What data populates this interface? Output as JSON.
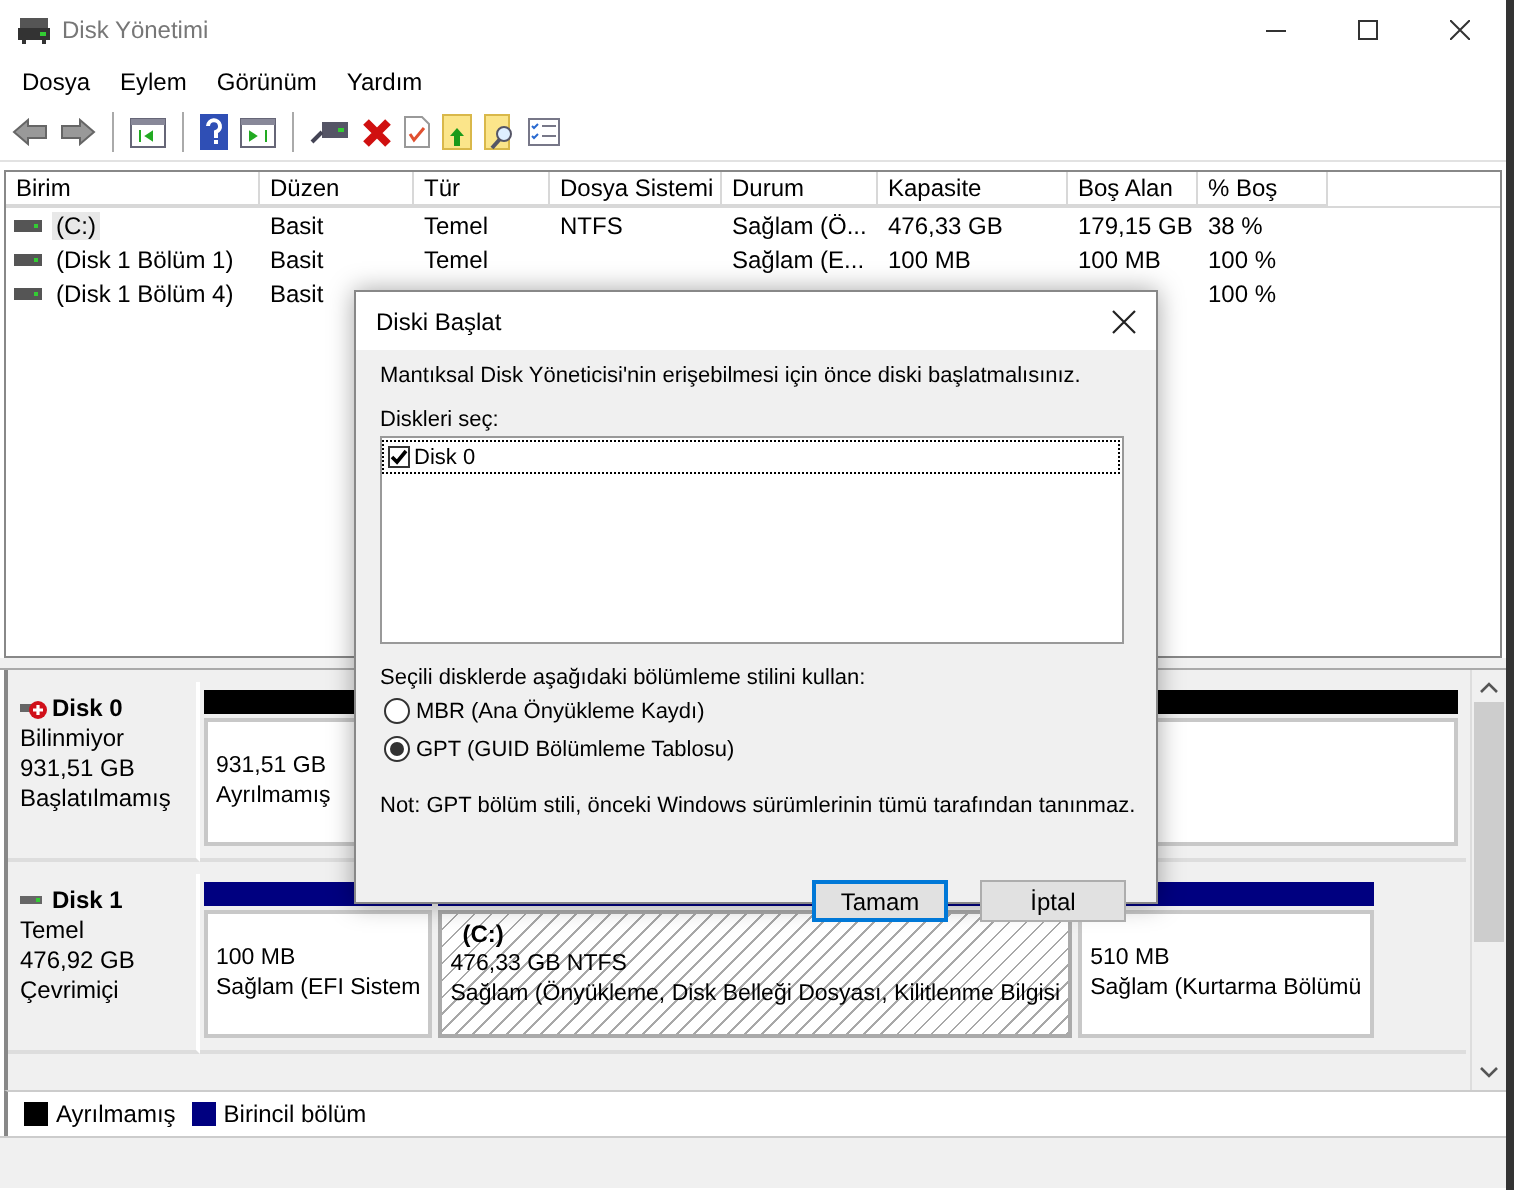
{
  "window": {
    "title": "Disk Yönetimi"
  },
  "menu": [
    "Dosya",
    "Eylem",
    "Görünüm",
    "Yardım"
  ],
  "volumes": {
    "columns": [
      "Birim",
      "Düzen",
      "Tür",
      "Dosya Sistemi",
      "Durum",
      "Kapasite",
      "Boş Alan",
      "% Boş"
    ],
    "rows": [
      {
        "name": "(C:)",
        "layout": "Basit",
        "type": "Temel",
        "fs": "NTFS",
        "status": "Sağlam (Ö...",
        "capacity": "476,33 GB",
        "free": "179,15 GB",
        "free_pct": "38 %",
        "selected": true
      },
      {
        "name": "(Disk 1 Bölüm 1)",
        "layout": "Basit",
        "type": "Temel",
        "status": "Sağlam (E...",
        "capacity": "100 MB",
        "free": "100 MB",
        "free_pct": "100 %",
        "selected": false
      },
      {
        "name": "(Disk 1 Bölüm 4)",
        "layout": "Basit",
        "free_pct": "100 %",
        "selected": false
      }
    ]
  },
  "disks": [
    {
      "name": "Disk 0",
      "error": true,
      "type": "Bilinmiyor",
      "size": "931,51 GB",
      "state": "Başlatılmamış",
      "partitions": [
        {
          "kind": "unallocated",
          "selected": false,
          "lines": [
            "931,51 GB",
            "Ayrılmamış"
          ]
        }
      ]
    },
    {
      "name": "Disk 1",
      "error": false,
      "type": "Temel",
      "size": "476,92 GB",
      "state": "Çevrimiçi",
      "partitions": [
        {
          "kind": "primary",
          "selected": false,
          "lines": [
            "100 MB",
            "Sağlam (EFI Sistem"
          ]
        },
        {
          "kind": "primary",
          "selected": true,
          "title": "(C:)",
          "lines": [
            "476,33 GB NTFS",
            "Sağlam (Önyükleme, Disk Belleği Dosyası, Kilitlenme Bilgisi"
          ]
        },
        {
          "kind": "primary",
          "selected": false,
          "lines": [
            "510 MB",
            "Sağlam (Kurtarma Bölümü"
          ]
        }
      ]
    }
  ],
  "legend": [
    {
      "label": "Ayrılmamış",
      "color": "#000000"
    },
    {
      "label": "Birincil bölüm",
      "color": "#000080"
    }
  ],
  "dialog": {
    "title": "Diski Başlat",
    "message": "Mantıksal Disk Yöneticisi'nin erişebilmesi için önce diski başlatmalısınız.",
    "disks_label": "Diskleri seç:",
    "disks": [
      {
        "label": "Disk 0",
        "checked": true,
        "selected": true
      }
    ],
    "style_label": "Seçili disklerde aşağıdaki bölümleme stilini kullan:",
    "styles": [
      {
        "label": "MBR (Ana Önyükleme Kaydı)",
        "selected": false
      },
      {
        "label": "GPT (GUID Bölümleme Tablosu)",
        "selected": true
      }
    ],
    "note": "Not: GPT bölüm stili, önceki Windows sürümlerinin tümü tarafından tanınmaz.",
    "buttons": [
      {
        "label": "Tamam",
        "default": true
      },
      {
        "label": "İptal",
        "default": false
      }
    ]
  }
}
